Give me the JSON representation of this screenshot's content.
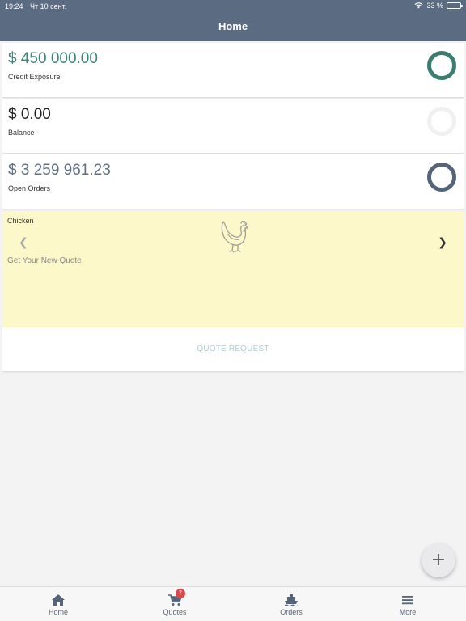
{
  "status_bar": {
    "time": "19:24",
    "date": "Чт 10 сент.",
    "battery": "33 %",
    "battery_level": 0.33
  },
  "header": {
    "title": "Home"
  },
  "stats": [
    {
      "value": "$ 450 000.00",
      "label": "Credit Exposure",
      "value_color": "#3b8378",
      "ring_color": "#3b7d70"
    },
    {
      "value": "$ 0.00",
      "label": "Balance",
      "value_color": "#222222",
      "ring_color": "#f0f0f0"
    },
    {
      "value": "$ 3 259 961.23",
      "label": "Open Orders",
      "value_color": "#5e6f86",
      "ring_color": "#566479"
    }
  ],
  "promo": {
    "title": "Chicken",
    "subtitle": "Get Your New Quote",
    "icon": "chicken-icon",
    "background": "#fdf8c9"
  },
  "quote_button": {
    "label": "QUOTE REQUEST",
    "color": "#a8cfd6"
  },
  "fab": {
    "label": "+"
  },
  "tabs": [
    {
      "label": "Home",
      "icon": "home-icon"
    },
    {
      "label": "Quotes",
      "icon": "cart-icon",
      "badge": "2"
    },
    {
      "label": "Orders",
      "icon": "ship-icon"
    },
    {
      "label": "More",
      "icon": "menu-icon"
    }
  ],
  "colors": {
    "header": "#5b6b82",
    "tab": "#556479",
    "badge": "#e04848"
  }
}
